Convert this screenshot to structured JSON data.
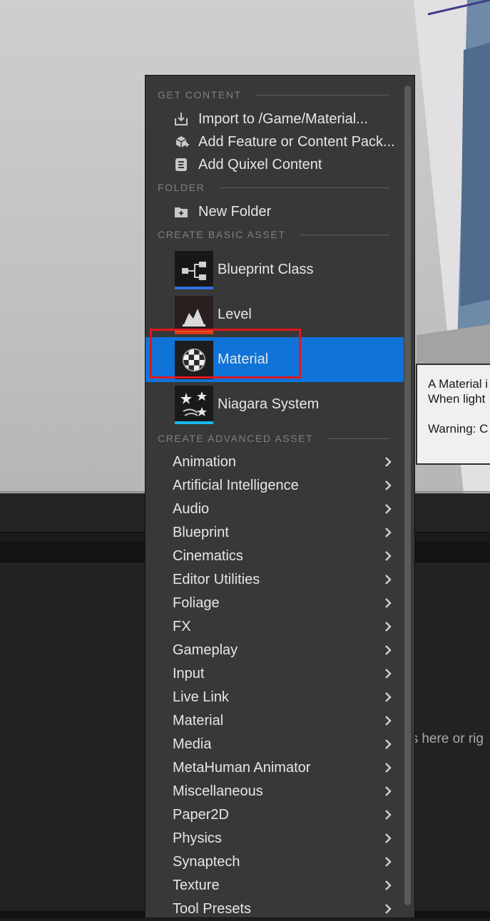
{
  "menu": {
    "get_content_header": "GET CONTENT",
    "get_content": [
      {
        "label": "Import to /Game/Material...",
        "icon": "import-icon"
      },
      {
        "label": "Add Feature or Content Pack...",
        "icon": "feature-pack-icon"
      },
      {
        "label": "Add Quixel Content",
        "icon": "quixel-icon"
      }
    ],
    "folder_header": "FOLDER",
    "folder_items": [
      {
        "label": "New Folder",
        "icon": "new-folder-icon"
      }
    ],
    "basic_header": "CREATE BASIC ASSET",
    "basic_assets": [
      {
        "label": "Blueprint Class",
        "icon": "blueprint-class-icon",
        "color": "#2f6fe0"
      },
      {
        "label": "Level",
        "icon": "level-icon",
        "color": "#e87c1e"
      },
      {
        "label": "Material",
        "icon": "material-icon",
        "color": "#6fd01d",
        "selected": true
      },
      {
        "label": "Niagara System",
        "icon": "niagara-icon",
        "color": "#19b8ef"
      }
    ],
    "advanced_header": "CREATE ADVANCED ASSET",
    "advanced_assets": [
      "Animation",
      "Artificial Intelligence",
      "Audio",
      "Blueprint",
      "Cinematics",
      "Editor Utilities",
      "Foliage",
      "FX",
      "Gameplay",
      "Input",
      "Live Link",
      "Material",
      "Media",
      "MetaHuman Animator",
      "Miscellaneous",
      "Paper2D",
      "Physics",
      "Synaptech",
      "Texture",
      "Tool Presets"
    ]
  },
  "tooltip": {
    "line1": "A Material i",
    "line2": "When light",
    "line3": "Warning: C"
  },
  "background": {
    "drop_hint": "es here or rig"
  },
  "colors": {
    "menu_bg": "#383838",
    "selected_bg": "#0f73d7",
    "highlight_border": "#e0181d"
  }
}
